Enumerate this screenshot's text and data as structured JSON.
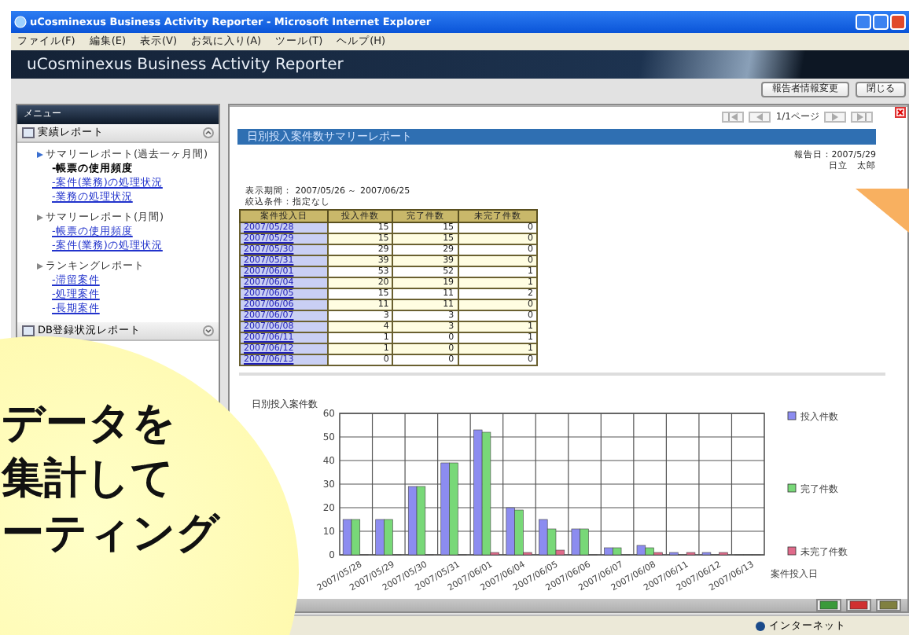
{
  "window": {
    "title": "uCosminexus Business Activity Reporter - Microsoft Internet Explorer"
  },
  "menu_bar": [
    "ファイル(F)",
    "編集(E)",
    "表示(V)",
    "お気に入り(A)",
    "ツール(T)",
    "ヘルプ(H)"
  ],
  "app_header": {
    "title": "uCosminexus Business Activity Reporter"
  },
  "toolbar": {
    "buttons": [
      "報告者情報変更",
      "閉じる"
    ]
  },
  "sidebar": {
    "title": "メニュー",
    "sections": [
      {
        "label": "実績レポート",
        "expanded": true,
        "groups": [
          {
            "label": "サマリーレポート(過去一ヶ月間)",
            "items": [
              {
                "label": "-帳票の使用頻度",
                "selected": true
              },
              {
                "label": "-案件(業務)の処理状況",
                "selected": false
              },
              {
                "label": "-業務の処理状況",
                "selected": false
              }
            ]
          },
          {
            "label": "サマリーレポート(月間)",
            "items": [
              {
                "label": "-帳票の使用頻度",
                "selected": false
              },
              {
                "label": "-案件(業務)の処理状況",
                "selected": false
              }
            ]
          },
          {
            "label": "ランキングレポート",
            "items": [
              {
                "label": "-滞留案件",
                "selected": false
              },
              {
                "label": "-処理案件",
                "selected": false
              },
              {
                "label": "-長期案件",
                "selected": false
              }
            ]
          }
        ]
      },
      {
        "label": "DB登録状況レポート",
        "expanded": false
      }
    ]
  },
  "report": {
    "pager": "1/1ページ",
    "title": "日別投入案件数サマリーレポート",
    "report_date": "報告日：2007/5/29",
    "reporter": "日立　太郎",
    "period": "表示期間： 2007/05/26 ～ 2007/06/25",
    "filter": "絞込条件：指定なし",
    "table": {
      "columns": [
        "案件投入日",
        "投入件数",
        "完了件数",
        "未完了件数"
      ],
      "rows": [
        [
          "2007/05/28",
          "15",
          "15",
          "0"
        ],
        [
          "2007/05/29",
          "15",
          "15",
          "0"
        ],
        [
          "2007/05/30",
          "29",
          "29",
          "0"
        ],
        [
          "2007/05/31",
          "39",
          "39",
          "0"
        ],
        [
          "2007/06/01",
          "53",
          "52",
          "1"
        ],
        [
          "2007/06/04",
          "20",
          "19",
          "1"
        ],
        [
          "2007/06/05",
          "15",
          "11",
          "2"
        ],
        [
          "2007/06/06",
          "11",
          "11",
          "0"
        ],
        [
          "2007/06/07",
          "3",
          "3",
          "0"
        ],
        [
          "2007/06/08",
          "4",
          "3",
          "1"
        ],
        [
          "2007/06/11",
          "1",
          "0",
          "1"
        ],
        [
          "2007/06/12",
          "1",
          "0",
          "1"
        ],
        [
          "2007/06/13",
          "0",
          "0",
          "0"
        ]
      ]
    },
    "chart_data": {
      "type": "bar",
      "title": "日別投入案件数",
      "xlabel": "案件投入日",
      "categories": [
        "2007/05/28",
        "2007/05/29",
        "2007/05/30",
        "2007/05/31",
        "2007/06/01",
        "2007/06/04",
        "2007/06/05",
        "2007/06/06",
        "2007/06/07",
        "2007/06/08",
        "2007/06/11",
        "2007/06/12",
        "2007/06/13"
      ],
      "series": [
        {
          "name": "投入件数",
          "color": "#8c8cf0",
          "values": [
            15,
            15,
            29,
            39,
            53,
            20,
            15,
            11,
            3,
            4,
            1,
            1,
            0
          ]
        },
        {
          "name": "完了件数",
          "color": "#78d878",
          "values": [
            15,
            15,
            29,
            39,
            52,
            19,
            11,
            11,
            3,
            3,
            0,
            0,
            0
          ]
        },
        {
          "name": "未完了件数",
          "color": "#e06a8a",
          "values": [
            0,
            0,
            0,
            0,
            1,
            1,
            2,
            0,
            0,
            1,
            1,
            1,
            0
          ]
        }
      ],
      "ylim": [
        0,
        60
      ],
      "yticks": [
        0,
        10,
        20,
        30,
        40,
        50,
        60
      ],
      "grid": true,
      "legend": true
    }
  },
  "callout": {
    "lines": [
      "データを",
      "集計して",
      "ーティング"
    ]
  },
  "status_bar": {
    "zone": "インターネット"
  }
}
